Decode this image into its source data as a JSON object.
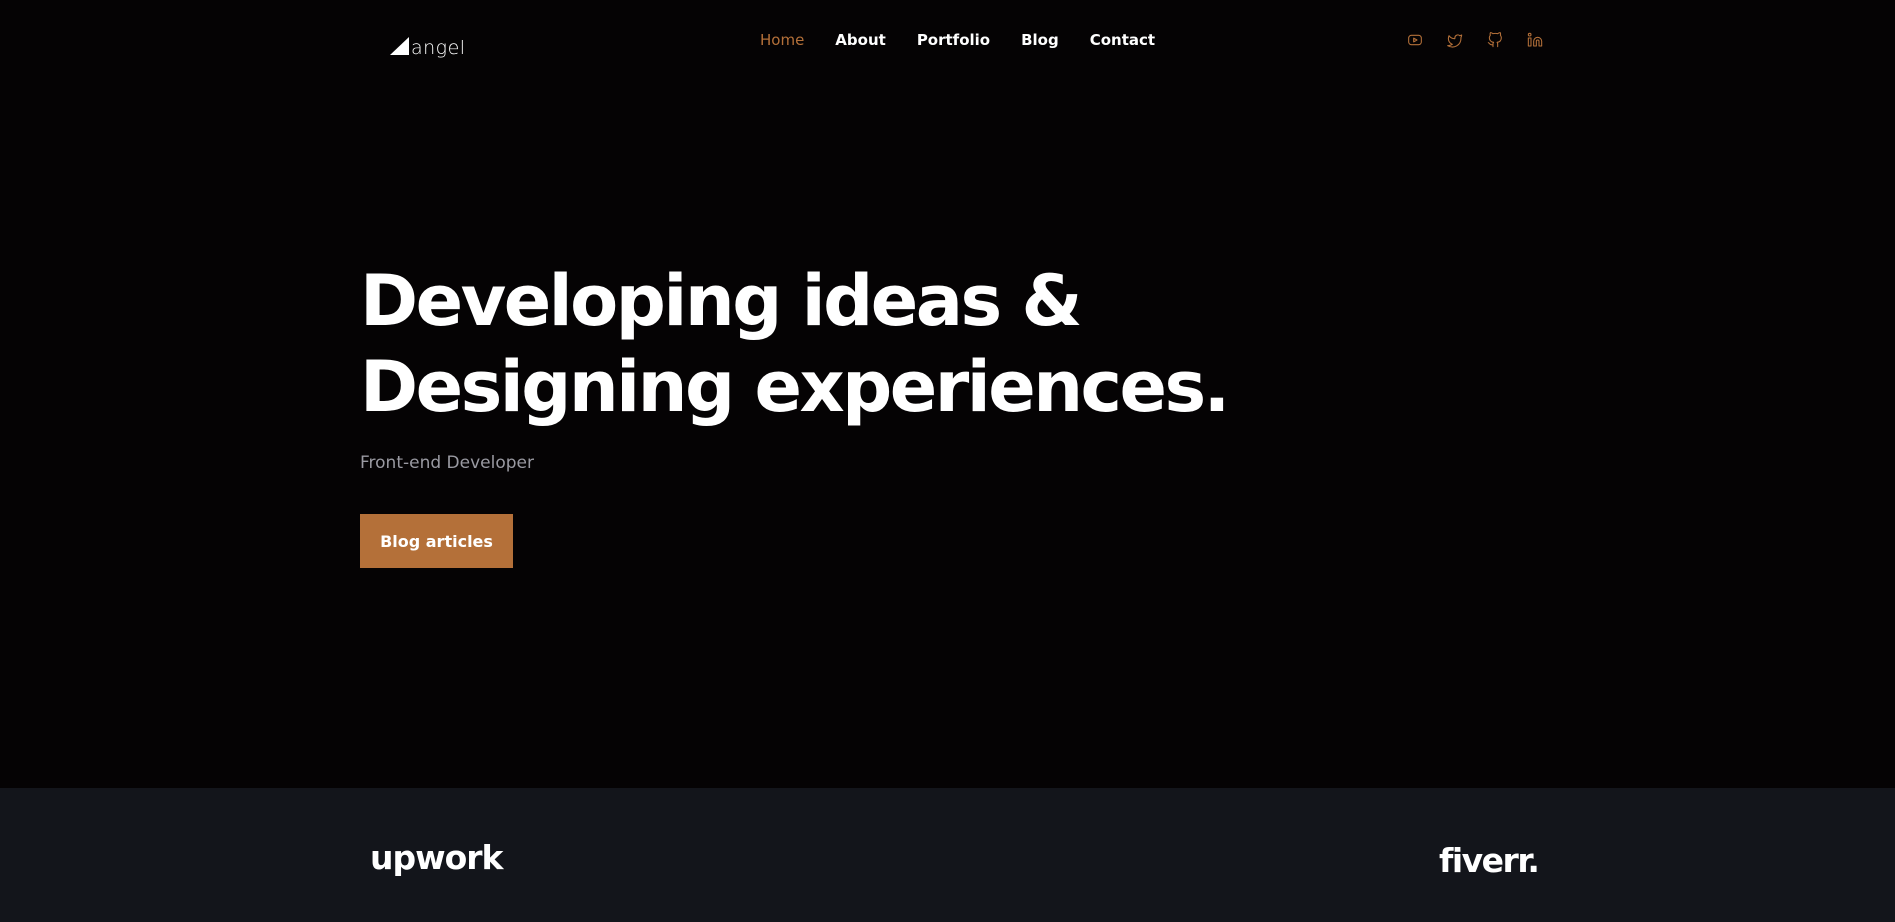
{
  "brand": {
    "logo_text": "angel",
    "accent_color": "#b47039",
    "background_color": "#050304"
  },
  "nav": {
    "items": [
      {
        "label": "Home",
        "active": true
      },
      {
        "label": "About",
        "active": false
      },
      {
        "label": "Portfolio",
        "active": false
      },
      {
        "label": "Blog",
        "active": false
      },
      {
        "label": "Contact",
        "active": false
      }
    ]
  },
  "socials": [
    {
      "icon": "youtube-icon"
    },
    {
      "icon": "twitter-icon"
    },
    {
      "icon": "github-icon"
    },
    {
      "icon": "linkedin-icon"
    }
  ],
  "hero": {
    "title_line1": "Developing ideas &",
    "title_line2": "Designing experiences.",
    "subtitle": "Front-end Developer",
    "cta_label": "Blog articles"
  },
  "partners": {
    "items": [
      {
        "name": "upwork"
      },
      {
        "name": "fiverr."
      }
    ],
    "background_color": "#13151b"
  }
}
